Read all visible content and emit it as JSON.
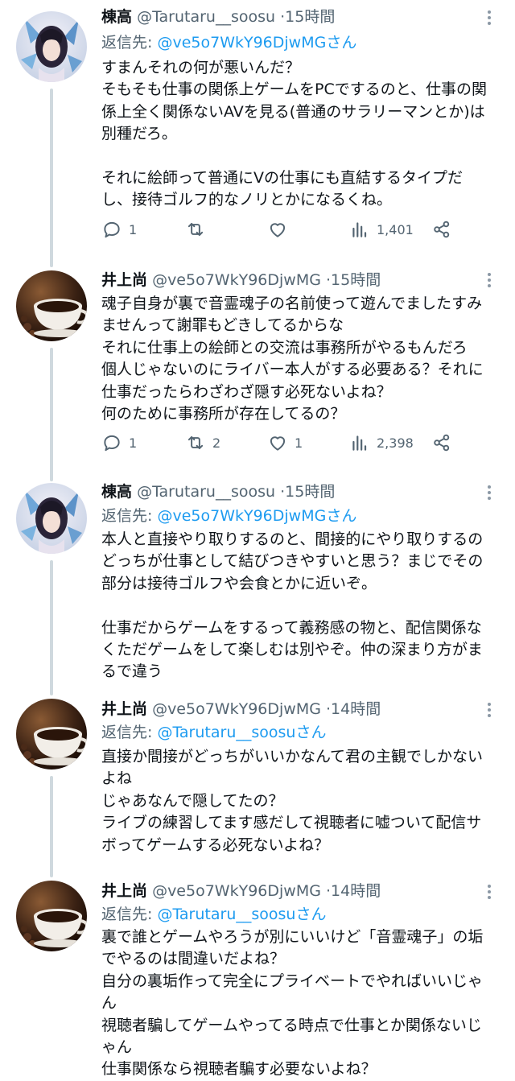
{
  "colors": {
    "text": "#0f1419",
    "muted": "#536471",
    "link": "#1d9bf0",
    "thread": "#cfd9de"
  },
  "icons": {
    "reply": "reply-icon",
    "retweet": "retweet-icon",
    "like": "like-icon",
    "views": "views-icon",
    "share": "share-icon",
    "more": "more-icon"
  },
  "tweets": [
    {
      "name": "棟高",
      "handle": "@Tarutaru__soosu",
      "time": "15時間",
      "reply_label": "返信先:",
      "reply_to": "@ve5o7WkY96DjwMGさん",
      "lines": [
        "すまんそれの何が悪いんだ？",
        "そもそも仕事の関係上ゲームをPCでするのと、仕事の関",
        "係上全く関係ないAVを見る(普通のサラリーマンとか)は",
        "別種だろ。",
        "",
        "それに絵師って普通にVの仕事にも直結するタイプだ",
        "し、接待ゴルフ的なノリとかになるくね。"
      ],
      "replies": "1",
      "retweets": "",
      "likes": "",
      "views": "1,401"
    },
    {
      "name": "井上尚",
      "handle": "@ve5o7WkY96DjwMG",
      "time": "15時間",
      "lines": [
        "魂子自身が裏で音霊魂子の名前使って遊んでましたすみ",
        "ませんって謝罪もどきしてるからな",
        "それに仕事上の絵師との交流は事務所がやるもんだろ",
        "個人じゃないのにライバー本人がする必要ある？それに",
        "仕事だったらわざわざ隠す必死ないよね？",
        "何のために事務所が存在してるの？"
      ],
      "replies": "1",
      "retweets": "2",
      "likes": "1",
      "views": "2,398"
    },
    {
      "name": "棟高",
      "handle": "@Tarutaru__soosu",
      "time": "15時間",
      "reply_label": "返信先:",
      "reply_to": "@ve5o7WkY96DjwMGさん",
      "lines": [
        "本人と直接やり取りするのと、間接的にやり取りするの",
        "どっちが仕事として結びつきやすいと思う？まじでその",
        "部分は接待ゴルフや会食とかに近いぞ。",
        "",
        "仕事だからゲームをするって義務感の物と、配信関係な",
        "くただゲームをして楽しむは別やぞ。仲の深まり方がま",
        "るで違う"
      ]
    },
    {
      "name": "井上尚",
      "handle": "@ve5o7WkY96DjwMG",
      "time": "14時間",
      "reply_label": "返信先:",
      "reply_to": "@Tarutaru__soosuさん",
      "lines": [
        "直接か間接がどっちがいいかなんて君の主観でしかない",
        "よね",
        "じゃあなんで隠してたの？",
        "ライブの練習してます感だして視聴者に嘘ついて配信サ",
        "ボってゲームする必死ないよね？"
      ]
    },
    {
      "name": "井上尚",
      "handle": "@ve5o7WkY96DjwMG",
      "time": "14時間",
      "reply_label": "返信先:",
      "reply_to": "@Tarutaru__soosuさん",
      "lines": [
        "裏で誰とゲームやろうが別にいいけど「音霊魂子」の垢",
        "でやるのは間違いだよね？",
        "自分の裏垢作って完全にプライベートでやればいいじゃ",
        "ん",
        "視聴者騙してゲームやってる時点で仕事とか関係ないじ",
        "ゃん",
        "仕事関係なら視聴者騙す必要ないよね？"
      ]
    }
  ]
}
